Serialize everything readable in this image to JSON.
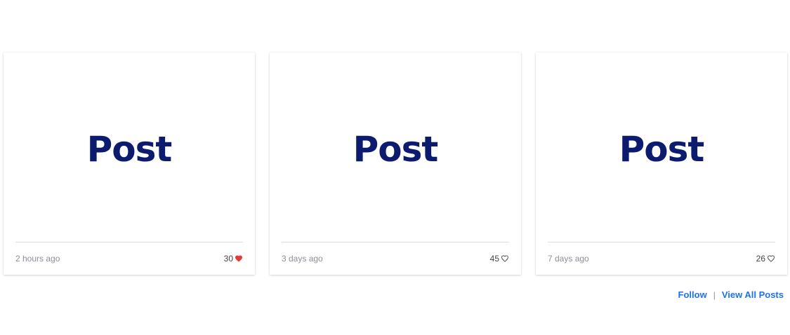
{
  "colors": {
    "title": "#0d1b6e",
    "link": "#1a73e8",
    "heart_filled": "#e53935",
    "heart_outline": "#555555"
  },
  "posts": [
    {
      "title": "Post",
      "timestamp": "2 hours ago",
      "likes": "30",
      "liked": true,
      "icon": "heart-filled-icon"
    },
    {
      "title": "Post",
      "timestamp": "3 days ago",
      "likes": "45",
      "liked": false,
      "icon": "heart-outline-icon"
    },
    {
      "title": "Post",
      "timestamp": "7 days ago",
      "likes": "26",
      "liked": false,
      "icon": "heart-outline-icon"
    }
  ],
  "footer": {
    "follow_label": "Follow",
    "separator": "|",
    "view_all_label": "View All Posts"
  }
}
